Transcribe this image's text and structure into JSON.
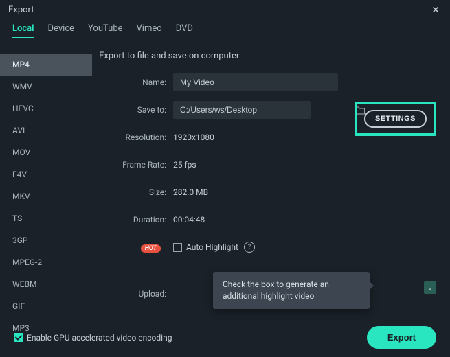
{
  "window": {
    "title": "Export"
  },
  "tabs": [
    {
      "label": "Local",
      "active": true
    },
    {
      "label": "Device"
    },
    {
      "label": "YouTube"
    },
    {
      "label": "Vimeo"
    },
    {
      "label": "DVD"
    }
  ],
  "formats": [
    {
      "label": "MP4",
      "active": true
    },
    {
      "label": "WMV"
    },
    {
      "label": "HEVC"
    },
    {
      "label": "AVI"
    },
    {
      "label": "MOV"
    },
    {
      "label": "F4V"
    },
    {
      "label": "MKV"
    },
    {
      "label": "TS"
    },
    {
      "label": "3GP"
    },
    {
      "label": "MPEG-2"
    },
    {
      "label": "WEBM"
    },
    {
      "label": "GIF"
    },
    {
      "label": "MP3"
    }
  ],
  "section_title": "Export to file and save on computer",
  "fields": {
    "name_label": "Name:",
    "name_value": "My Video",
    "saveto_label": "Save to:",
    "saveto_value": "C:/Users/ws/Desktop",
    "resolution_label": "Resolution:",
    "resolution_value": "1920x1080",
    "framerate_label": "Frame Rate:",
    "framerate_value": "25 fps",
    "size_label": "Size:",
    "size_value": "282.0 MB",
    "duration_label": "Duration:",
    "duration_value": "00:04:48",
    "upload_label": "Upload:"
  },
  "settings_button": "SETTINGS",
  "hot_badge": "HOT",
  "auto_highlight_label": "Auto Highlight",
  "tooltip_text": "Check the box to generate an additional highlight video",
  "gpu_label": "Enable GPU accelerated video encoding",
  "export_button": "Export"
}
